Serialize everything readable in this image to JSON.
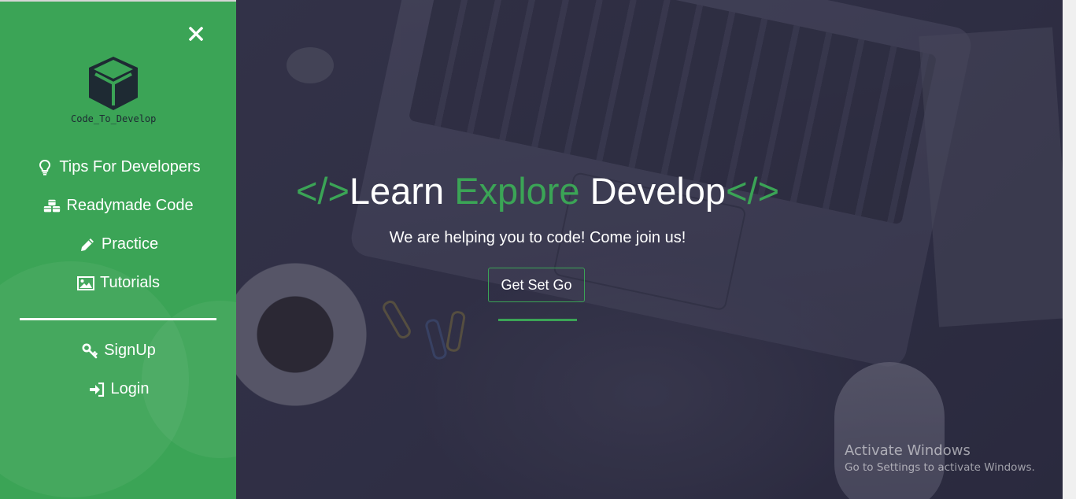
{
  "sidebar": {
    "close_icon": "close-icon",
    "logo_text": "Code_To_Develop",
    "nav_items": [
      {
        "label": "Tips For Developers",
        "icon": "lightbulb-icon"
      },
      {
        "label": "Readymade Code",
        "icon": "cubes-icon"
      },
      {
        "label": "Practice",
        "icon": "pencil-icon"
      },
      {
        "label": "Tutorials",
        "icon": "image-icon"
      }
    ],
    "account_items": [
      {
        "label": "SignUp",
        "icon": "key-icon"
      },
      {
        "label": "Login",
        "icon": "sign-in-icon"
      }
    ]
  },
  "hero": {
    "headline": {
      "open_tag": "</>",
      "word1": "Learn",
      "word2": "Explore",
      "word3": "Develop",
      "close_tag": "</>"
    },
    "subtitle": "We are helping you to code! Come join us!",
    "cta_label": "Get Set Go"
  },
  "watermark": {
    "title": "Activate Windows",
    "subtitle": "Go to Settings to activate Windows."
  },
  "colors": {
    "accent": "#3ba456",
    "hero_overlay": "#2f2f45",
    "text": "#ffffff"
  }
}
